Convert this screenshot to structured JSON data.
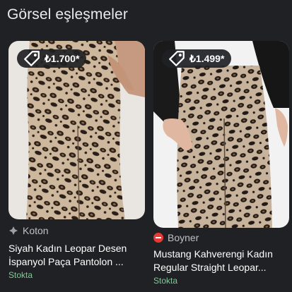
{
  "section": {
    "title": "Görsel eşleşmeler"
  },
  "cards": [
    {
      "price": "₺1.700*",
      "source_icon": "koton-logo-icon",
      "source": "Koton",
      "title": "Siyah Kadın Leopar Desen\nİspanyol Paça Pantolon ...",
      "stock": "Stokta"
    },
    {
      "price": "₺1.499*",
      "source_icon": "boyner-logo-icon",
      "source": "Boyner",
      "title": "Mustang Kahverengi Kadın\nRegular Straight Leopar...",
      "stock": "Stokta"
    }
  ],
  "colors": {
    "background": "#202124",
    "stock_green": "#81c995",
    "boyner_red": "#e53935"
  }
}
